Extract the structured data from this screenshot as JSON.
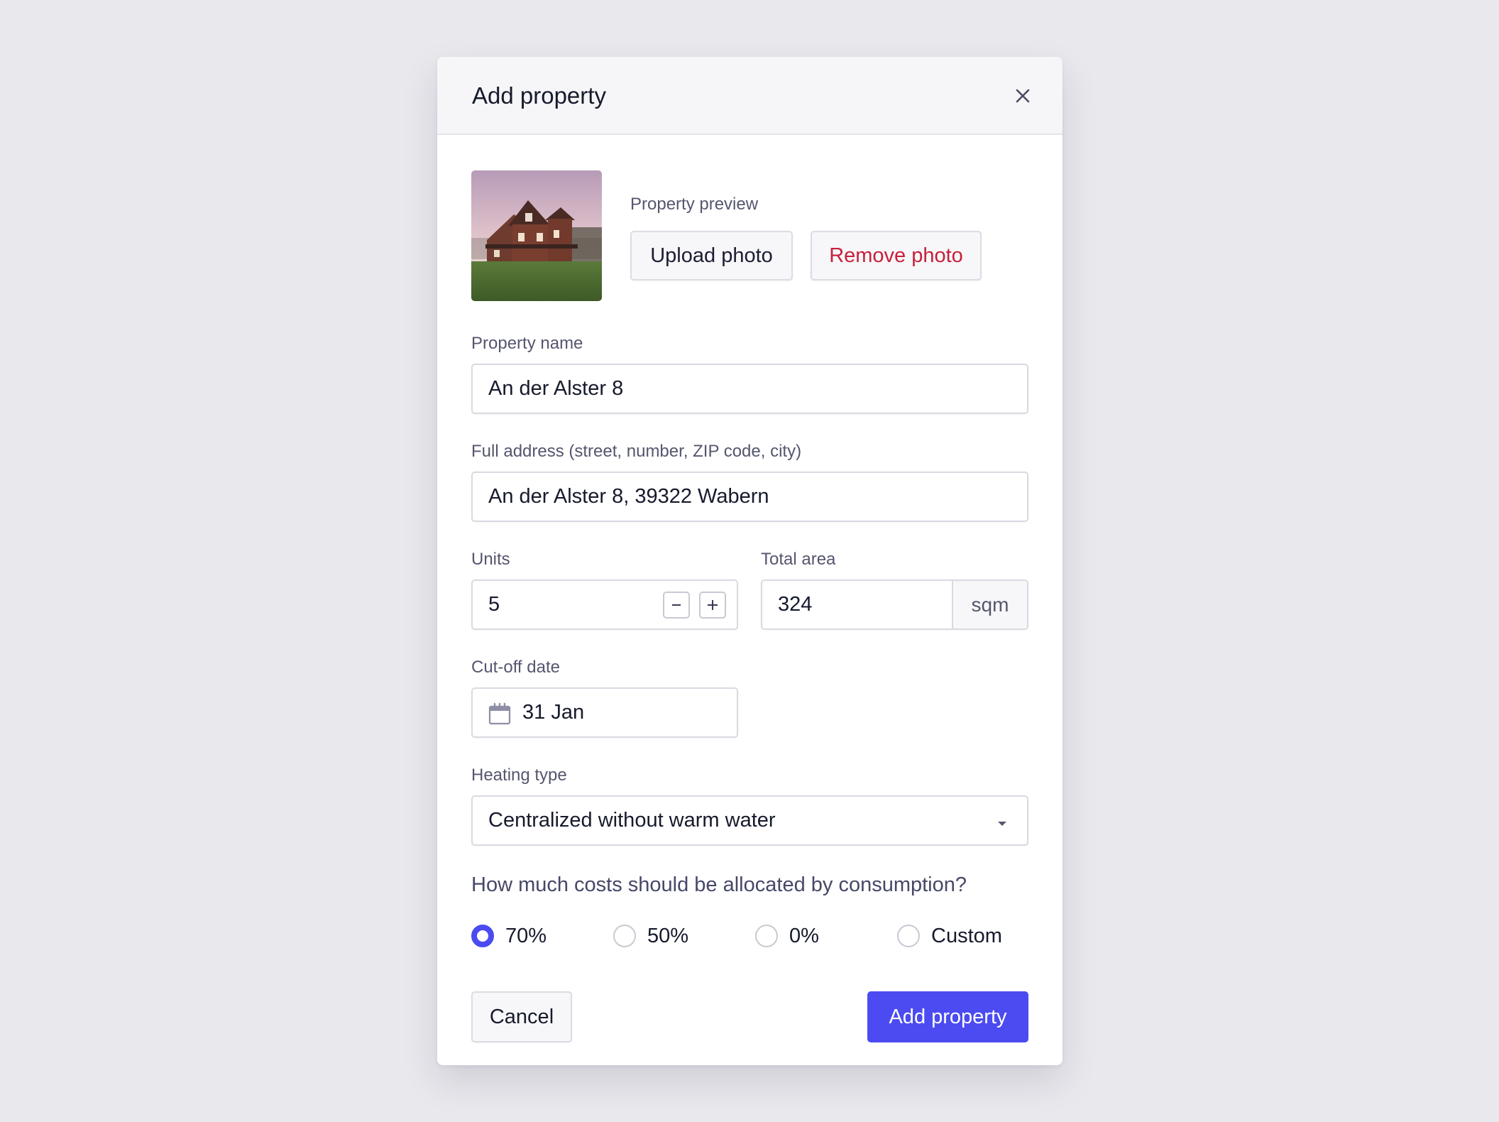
{
  "dialog": {
    "title": "Add property",
    "close_icon": "close-icon"
  },
  "photo": {
    "preview_label": "Property preview",
    "upload_label": "Upload photo",
    "remove_label": "Remove photo"
  },
  "form": {
    "name": {
      "label": "Property name",
      "value": "An der Alster 8"
    },
    "address": {
      "label": "Full address (street, number, ZIP code, city)",
      "value": "An der Alster 8, 39322 Wabern"
    },
    "units": {
      "label": "Units",
      "value": "5"
    },
    "area": {
      "label": "Total area",
      "value": "324",
      "unit": "sqm"
    },
    "cutoff": {
      "label": "Cut-off date",
      "value": "31 Jan",
      "icon": "calendar-icon"
    },
    "heating": {
      "label": "Heating type",
      "value": "Centralized without warm water"
    },
    "allocation": {
      "question": "How much costs should be allocated by consumption?",
      "options": [
        "70%",
        "50%",
        "0%",
        "Custom"
      ],
      "selected": "70%"
    }
  },
  "footer": {
    "cancel_label": "Cancel",
    "submit_label": "Add property"
  },
  "colors": {
    "primary": "#4b4bf1",
    "danger": "#c71f3b",
    "background": "#e9e8ed"
  }
}
